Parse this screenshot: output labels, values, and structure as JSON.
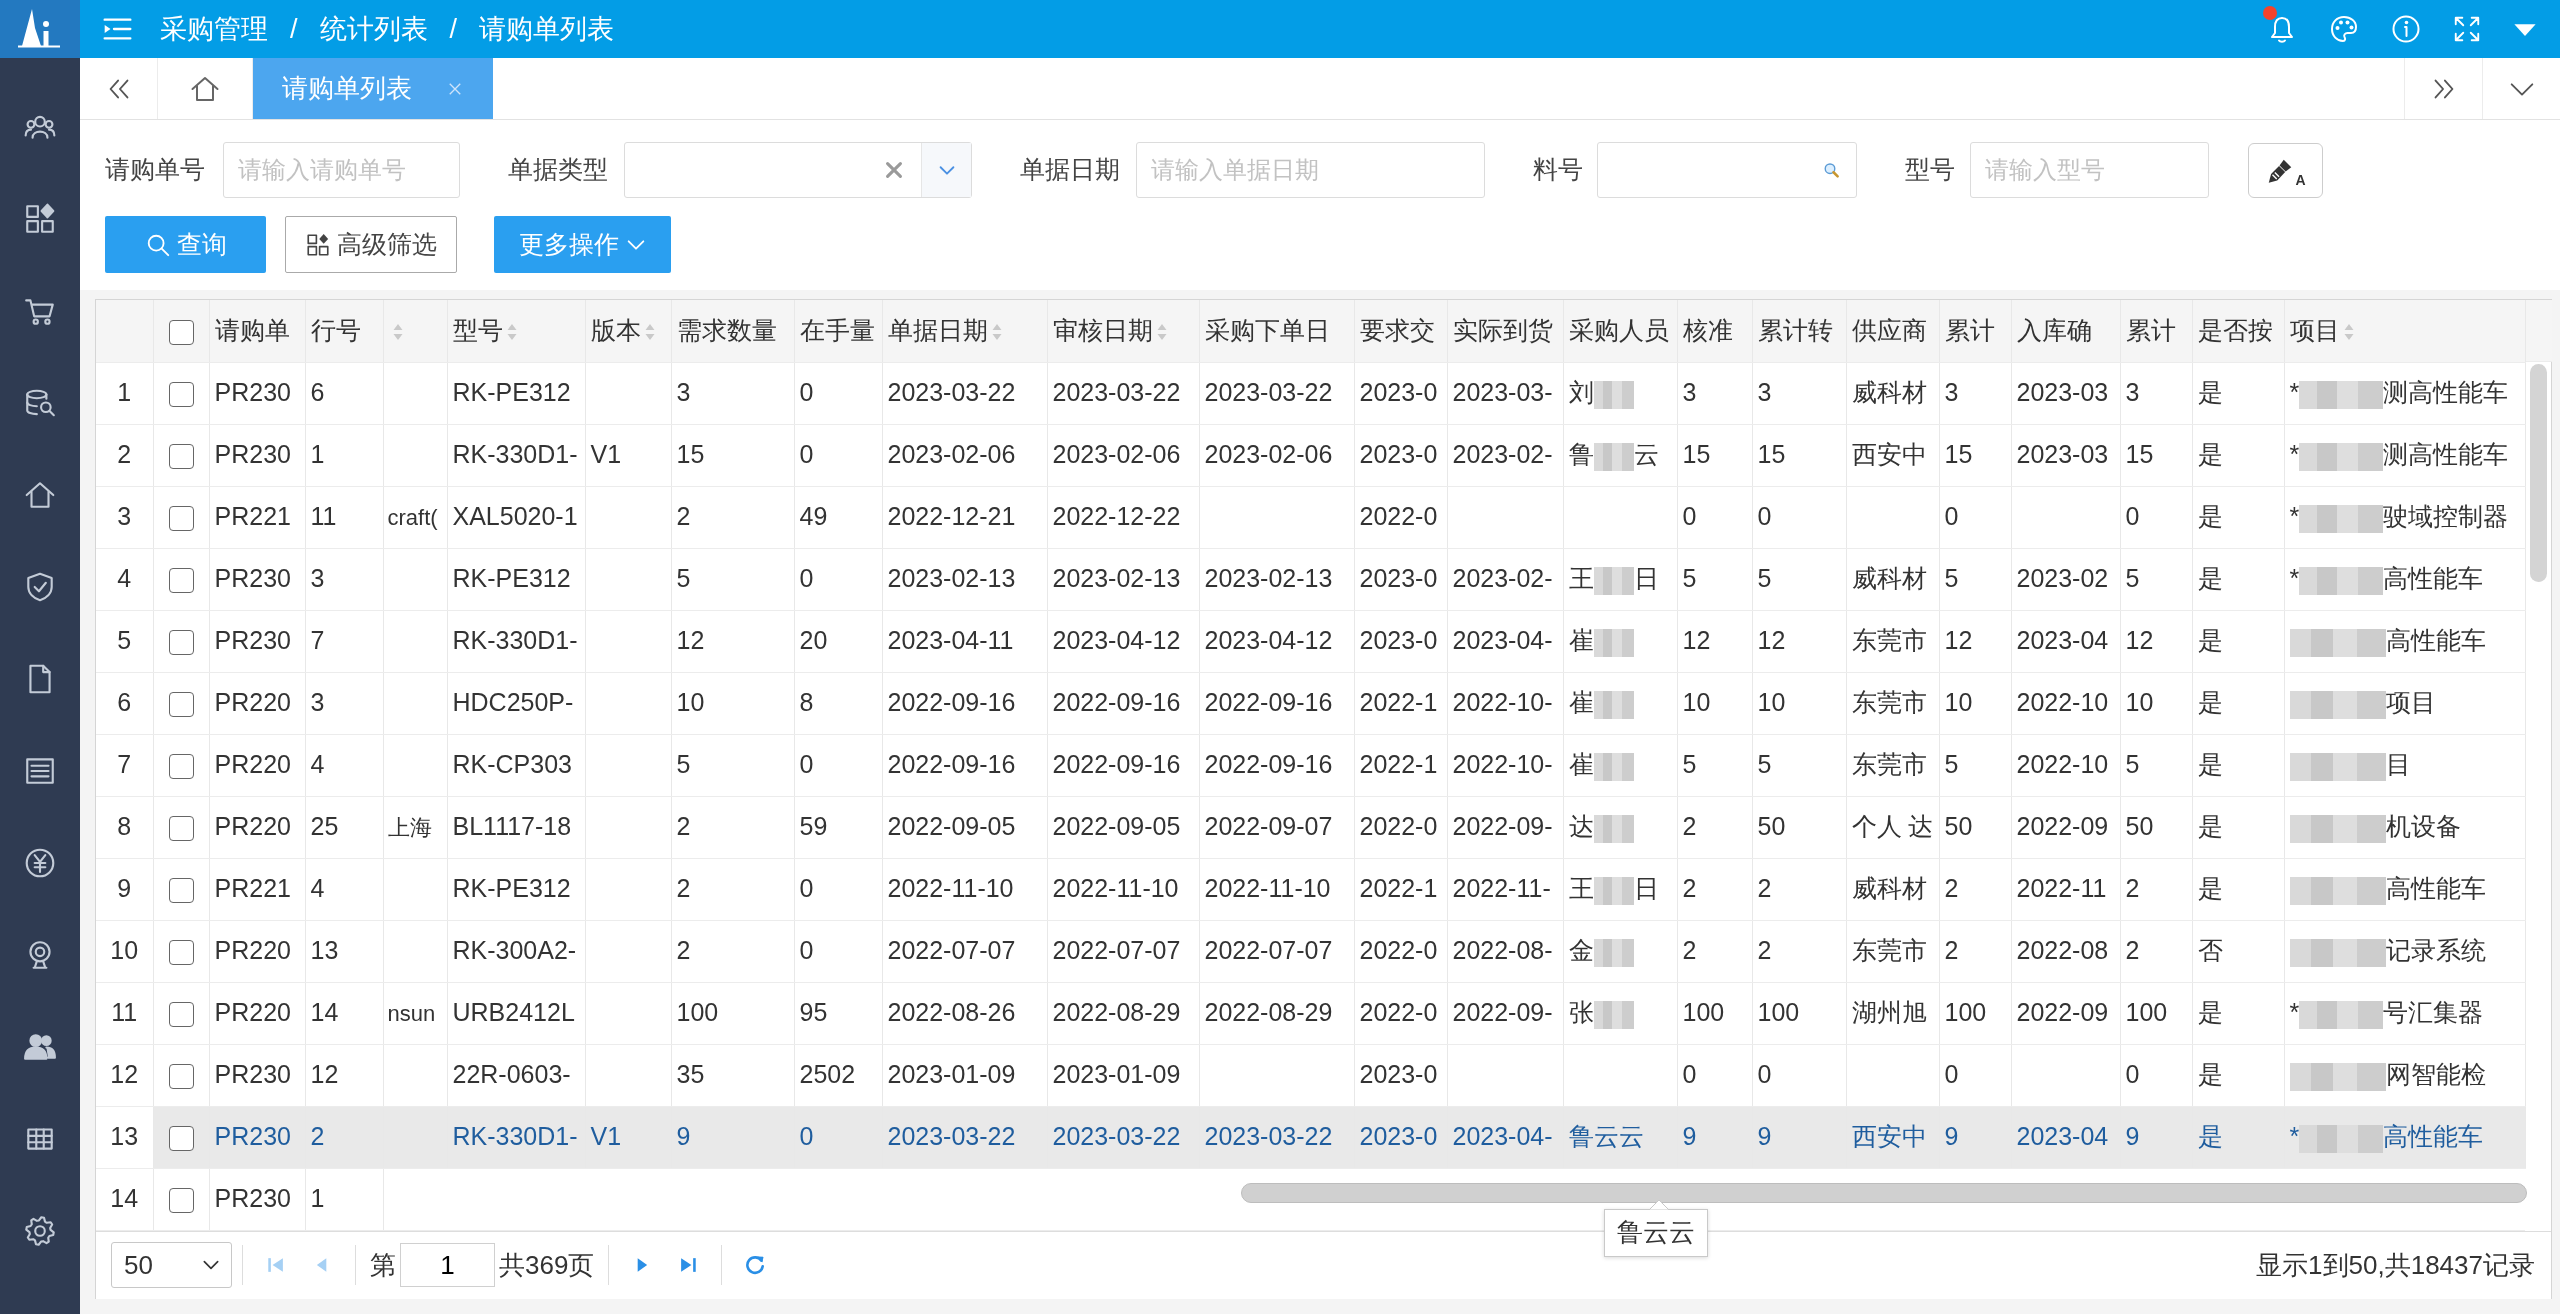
{
  "top_bar": {
    "breadcrumbs": [
      {
        "label": "采购管理",
        "separator": "/"
      },
      {
        "label": "统计列表",
        "separator": "/"
      },
      {
        "label": "请购单列表"
      }
    ],
    "notification": true
  },
  "tabs": [
    {
      "kind": "home",
      "selected": false
    },
    {
      "kind": "page",
      "label": "请购单列表",
      "selected": true,
      "closable": true
    }
  ],
  "filters": [
    {
      "kind": "text",
      "label": "请购单号",
      "placeholder": "请输入请购单号"
    },
    {
      "kind": "select",
      "label": "单据类型"
    },
    {
      "kind": "text",
      "label": "单据日期",
      "placeholder": "请输入单据日期"
    },
    {
      "kind": "search",
      "label": "料号"
    },
    {
      "kind": "text",
      "label": "型号",
      "placeholder": "请输入型号"
    }
  ],
  "reset_button": {
    "label": "A"
  },
  "actions": [
    {
      "kind": "search",
      "label": "查询"
    },
    {
      "kind": "advanced",
      "label": "高级筛选"
    },
    {
      "kind": "dropdown",
      "label": "更多操作"
    }
  ],
  "table": {
    "select_all": {
      "checked": false
    },
    "columns": [
      {
        "label": "请购单",
        "sortable": false
      },
      {
        "label": "行号",
        "sortable": false
      },
      {
        "sortable": true
      },
      {
        "label": "型号",
        "sortable": true
      },
      {
        "label": "版本",
        "sortable": true
      },
      {
        "label": "需求数量",
        "sortable": false
      },
      {
        "label": "在手量",
        "sortable": false
      },
      {
        "label": "单据日期",
        "sortable": true
      },
      {
        "label": "审核日期",
        "sortable": true
      },
      {
        "label": "采购下单日",
        "sortable": false
      },
      {
        "label": "要求交",
        "sortable": false
      },
      {
        "label": "实际到货",
        "sortable": false
      },
      {
        "label": "采购人员",
        "sortable": false
      },
      {
        "label": "核准",
        "sortable": false
      },
      {
        "label": "累计转",
        "sortable": false
      },
      {
        "label": "供应商",
        "sortable": false
      },
      {
        "label": "累计",
        "sortable": false
      },
      {
        "label": "入库确",
        "sortable": false
      },
      {
        "label": "累计",
        "sortable": false
      },
      {
        "label": "是否按",
        "sortable": false
      },
      {
        "label": "项目",
        "sortable": true
      }
    ],
    "rows": [
      {
        "number": "1",
        "checked": false,
        "selected": false,
        "cells": [
          "PR230",
          "6",
          null,
          "RK-PE312",
          null,
          "3",
          "0",
          "2023-03-22",
          "2023-03-22",
          "2023-03-22",
          "2023-0",
          "2023-03-",
          {
            "kind": "redacted",
            "before": "刘"
          },
          "3",
          "3",
          "威科材",
          "3",
          "2023-03",
          "3",
          "是",
          {
            "kind": "redacted",
            "before": "*",
            "after": "测高性能车"
          }
        ]
      },
      {
        "number": "2",
        "checked": false,
        "selected": false,
        "cells": [
          "PR230",
          "1",
          null,
          "RK-330D1-",
          "V1",
          "15",
          "0",
          "2023-02-06",
          "2023-02-06",
          "2023-02-06",
          "2023-0",
          "2023-02-",
          {
            "kind": "redacted",
            "before": "鲁",
            "after": "云"
          },
          "15",
          "15",
          "西安中",
          "15",
          "2023-03",
          "15",
          "是",
          {
            "kind": "redacted",
            "before": "*",
            "after": "测高性能车"
          }
        ]
      },
      {
        "number": "3",
        "checked": false,
        "selected": false,
        "cells": [
          "PR221",
          "11",
          "craft(",
          "XAL5020-1",
          null,
          "2",
          "49",
          "2022-12-21",
          "2022-12-22",
          null,
          "2022-0",
          null,
          null,
          "0",
          "0",
          null,
          "0",
          null,
          "0",
          "是",
          {
            "kind": "redacted",
            "before": "*",
            "after": "驶域控制器"
          }
        ]
      },
      {
        "number": "4",
        "checked": false,
        "selected": false,
        "cells": [
          "PR230",
          "3",
          null,
          "RK-PE312",
          null,
          "5",
          "0",
          "2023-02-13",
          "2023-02-13",
          "2023-02-13",
          "2023-0",
          "2023-02-",
          {
            "kind": "redacted",
            "before": "王",
            "after": "日"
          },
          "5",
          "5",
          "威科材",
          "5",
          "2023-02",
          "5",
          "是",
          {
            "kind": "redacted",
            "before": "*",
            "after": "高性能车"
          }
        ]
      },
      {
        "number": "5",
        "checked": false,
        "selected": false,
        "cells": [
          "PR230",
          "7",
          null,
          "RK-330D1-",
          null,
          "12",
          "20",
          "2023-04-11",
          "2023-04-12",
          "2023-04-12",
          "2023-0",
          "2023-04-",
          {
            "kind": "redacted",
            "before": "崔"
          },
          "12",
          "12",
          "东莞市",
          "12",
          "2023-04",
          "12",
          "是",
          {
            "kind": "redacted",
            "after": "高性能车"
          }
        ]
      },
      {
        "number": "6",
        "checked": false,
        "selected": false,
        "cells": [
          "PR220",
          "3",
          null,
          "HDC250P-",
          null,
          "10",
          "8",
          "2022-09-16",
          "2022-09-16",
          "2022-09-16",
          "2022-1",
          "2022-10-",
          {
            "kind": "redacted",
            "before": "崔"
          },
          "10",
          "10",
          "东莞市",
          "10",
          "2022-10",
          "10",
          "是",
          {
            "kind": "redacted",
            "after": "项目"
          }
        ]
      },
      {
        "number": "7",
        "checked": false,
        "selected": false,
        "cells": [
          "PR220",
          "4",
          null,
          "RK-CP303",
          null,
          "5",
          "0",
          "2022-09-16",
          "2022-09-16",
          "2022-09-16",
          "2022-1",
          "2022-10-",
          {
            "kind": "redacted",
            "before": "崔"
          },
          "5",
          "5",
          "东莞市",
          "5",
          "2022-10",
          "5",
          "是",
          {
            "kind": "redacted",
            "after": "目"
          }
        ]
      },
      {
        "number": "8",
        "checked": false,
        "selected": false,
        "cells": [
          "PR220",
          "25",
          "上海",
          "BL1117-18",
          null,
          "2",
          "59",
          "2022-09-05",
          "2022-09-05",
          "2022-09-07",
          "2022-0",
          "2022-09-",
          {
            "kind": "redacted",
            "before": "达"
          },
          "2",
          "50",
          "个人 达",
          "50",
          "2022-09",
          "50",
          "是",
          {
            "kind": "redacted",
            "after": "机设备"
          }
        ]
      },
      {
        "number": "9",
        "checked": false,
        "selected": false,
        "cells": [
          "PR221",
          "4",
          null,
          "RK-PE312",
          null,
          "2",
          "0",
          "2022-11-10",
          "2022-11-10",
          "2022-11-10",
          "2022-1",
          "2022-11-",
          {
            "kind": "redacted",
            "before": "王",
            "after": "日"
          },
          "2",
          "2",
          "威科材",
          "2",
          "2022-11",
          "2",
          "是",
          {
            "kind": "redacted",
            "after": "高性能车"
          }
        ]
      },
      {
        "number": "10",
        "checked": false,
        "selected": false,
        "cells": [
          "PR220",
          "13",
          null,
          "RK-300A2-",
          null,
          "2",
          "0",
          "2022-07-07",
          "2022-07-07",
          "2022-07-07",
          "2022-0",
          "2022-08-",
          {
            "kind": "redacted",
            "before": "金"
          },
          "2",
          "2",
          "东莞市",
          "2",
          "2022-08",
          "2",
          "否",
          {
            "kind": "redacted",
            "after": "记录系统"
          }
        ]
      },
      {
        "number": "11",
        "checked": false,
        "selected": false,
        "cells": [
          "PR220",
          "14",
          "nsun",
          "URB2412L",
          null,
          "100",
          "95",
          "2022-08-26",
          "2022-08-29",
          "2022-08-29",
          "2022-0",
          "2022-09-",
          {
            "kind": "redacted",
            "before": "张"
          },
          "100",
          "100",
          "湖州旭",
          "100",
          "2022-09",
          "100",
          "是",
          {
            "kind": "redacted",
            "before": "*",
            "after": "号汇集器"
          }
        ]
      },
      {
        "number": "12",
        "checked": false,
        "selected": false,
        "cells": [
          "PR230",
          "12",
          null,
          "22R-0603-",
          null,
          "35",
          "2502",
          "2023-01-09",
          "2023-01-09",
          null,
          "2023-0",
          null,
          null,
          "0",
          "0",
          null,
          "0",
          null,
          "0",
          "是",
          {
            "kind": "redacted",
            "after": "网智能检"
          }
        ]
      },
      {
        "number": "13",
        "checked": false,
        "selected": true,
        "cells": [
          "PR230",
          "2",
          null,
          "RK-330D1-",
          "V1",
          "9",
          "0",
          "2023-03-22",
          "2023-03-22",
          "2023-03-22",
          "2023-0",
          "2023-04-",
          {
            "kind": "text",
            "text": "鲁云云",
            "tooltip": "鲁云云"
          },
          "9",
          "9",
          "西安中",
          "9",
          "2023-04",
          "9",
          "是",
          {
            "kind": "redacted",
            "before": "*",
            "after": "高性能车"
          }
        ]
      },
      {
        "number": "14",
        "checked": false,
        "selected": false,
        "cells": [
          "PR230",
          "1"
        ]
      }
    ]
  },
  "pagination": {
    "page_size": "50",
    "controls": [
      {
        "kind": "first",
        "disabled": true
      },
      {
        "kind": "prev",
        "disabled": true
      },
      {
        "kind": "page",
        "prefix": "第",
        "value": "1",
        "suffix": "共369页"
      },
      {
        "kind": "next",
        "disabled": false
      },
      {
        "kind": "last",
        "disabled": false
      },
      {
        "kind": "refresh",
        "disabled": false
      }
    ],
    "summary": "显示1到50,共18437记录"
  }
}
